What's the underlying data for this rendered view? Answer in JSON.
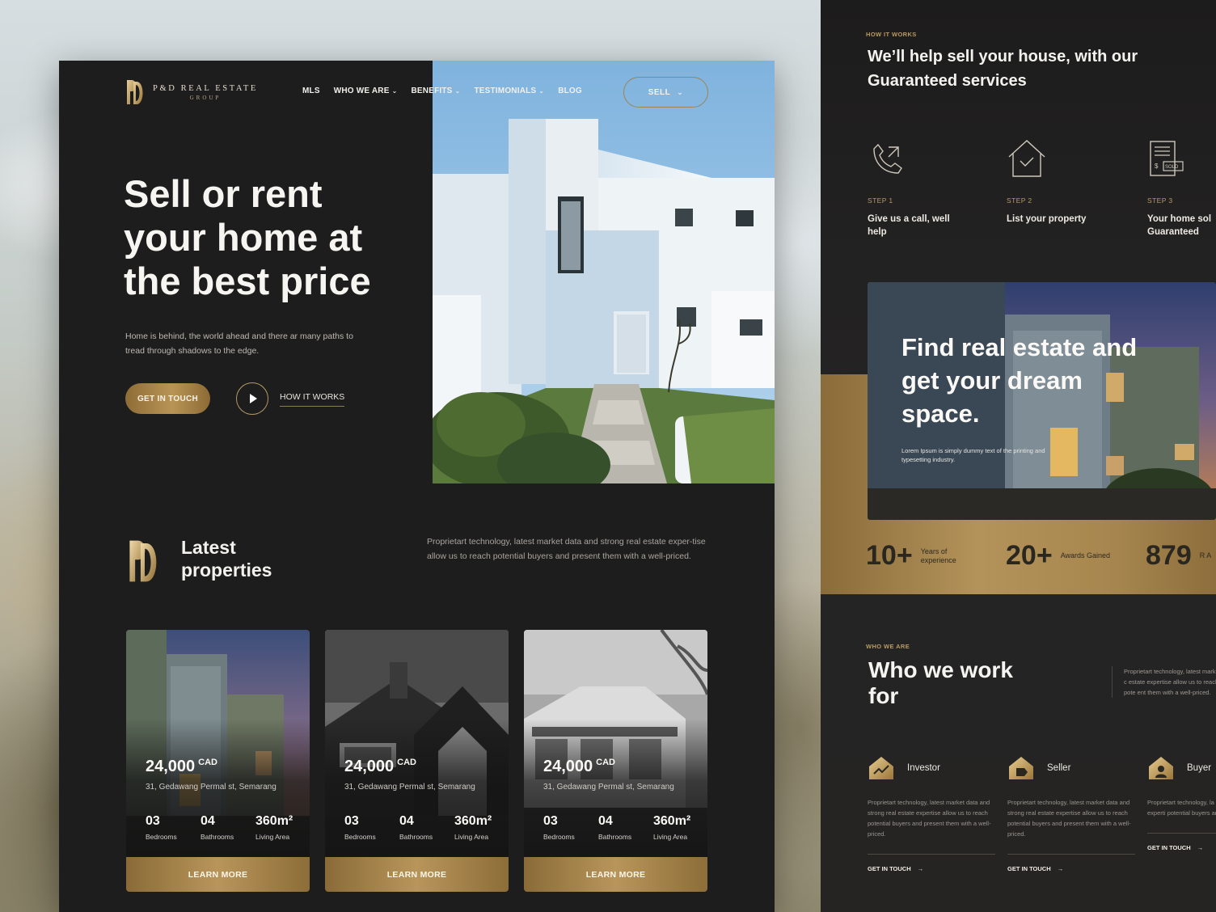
{
  "brand": {
    "name_line1": "P&D REAL ESTATE",
    "name_line2": "GROUP",
    "gold": "#b8955a",
    "dark": "#1e1d1d"
  },
  "nav": {
    "items": [
      {
        "label": "MLS",
        "has_menu": false
      },
      {
        "label": "WHO WE ARE",
        "has_menu": true
      },
      {
        "label": "BENEFITS",
        "has_menu": true
      },
      {
        "label": "TESTIMONIALS",
        "has_menu": true
      },
      {
        "label": "BLOG",
        "has_menu": false
      }
    ],
    "sell_label": "SELL"
  },
  "hero": {
    "title": "Sell or rent your home at the best price",
    "description": "Home is behind, the world ahead and there ar many paths to tread through shadows to the edge.",
    "primary_cta": "GET IN TOUCH",
    "secondary_cta": "HOW IT WORKS"
  },
  "latest": {
    "title": "Latest properties",
    "description": "Proprietart technology, latest market data and strong real estate exper-tise allow us to reach potential buyers and present them with a well-priced.",
    "cards": [
      {
        "price": "24,000",
        "currency": "CAD",
        "address": "31, Gedawang Permal st, Semarang",
        "bedrooms": "03",
        "bedrooms_label": "Bedrooms",
        "bathrooms": "04",
        "bathrooms_label": "Bathrooms",
        "area": "360m²",
        "area_label": "Living Area",
        "cta": "LEARN MORE"
      },
      {
        "price": "24,000",
        "currency": "CAD",
        "address": "31, Gedawang Permal st, Semarang",
        "bedrooms": "03",
        "bedrooms_label": "Bedrooms",
        "bathrooms": "04",
        "bathrooms_label": "Bathrooms",
        "area": "360m²",
        "area_label": "Living Area",
        "cta": "LEARN MORE"
      },
      {
        "price": "24,000",
        "currency": "CAD",
        "address": "31, Gedawang Permal st, Semarang",
        "bedrooms": "03",
        "bedrooms_label": "Bedrooms",
        "bathrooms": "04",
        "bathrooms_label": "Bathrooms",
        "area": "360m²",
        "area_label": "Living Area",
        "cta": "LEARN MORE"
      }
    ]
  },
  "how_it_works": {
    "eyebrow": "HOW IT WORKS",
    "title": "We’ll help sell your house, with our Guaranteed services",
    "steps": [
      {
        "label": "STEP 1",
        "text": "Give us a call, well help",
        "icon": "phone-icon"
      },
      {
        "label": "STEP 2",
        "text": "List your property",
        "icon": "house-check-icon"
      },
      {
        "label": "STEP 3",
        "text": "Your home sol Guaranteed",
        "icon": "sold-document-icon"
      }
    ]
  },
  "feature": {
    "title": "Find real estate and get your dream space.",
    "description": "Lorem Ipsum is simply dummy text of the printing and typesetting industry."
  },
  "counters": [
    {
      "value": "10+",
      "caption": "Years of experience"
    },
    {
      "value": "20+",
      "caption": "Awards Gained"
    },
    {
      "value": "879",
      "caption": "R A"
    }
  ],
  "who_we_are": {
    "eyebrow": "WHO WE ARE",
    "title": "Who we work for",
    "description": "Proprietart technology, latest market c estate expertise allow us to reach pote ent them with a well-priced.",
    "roles": [
      {
        "name": "Investor",
        "icon": "investor-house-icon",
        "body": "Proprietart technology, latest market data and strong real estate expertise allow us to reach potential buyers and present them with a well-priced.",
        "cta": "GET IN TOUCH"
      },
      {
        "name": "Seller",
        "icon": "seller-house-icon",
        "body": "Proprietart technology, latest market data and strong real estate expertise allow us to reach potential buyers and present them with a well-priced.",
        "cta": "GET IN TOUCH"
      },
      {
        "name": "Buyer",
        "icon": "buyer-house-icon",
        "body": "Proprietart technology, la strong real estate experti potential buyers and pres well-priced.",
        "cta": "GET IN TOUCH"
      }
    ]
  }
}
